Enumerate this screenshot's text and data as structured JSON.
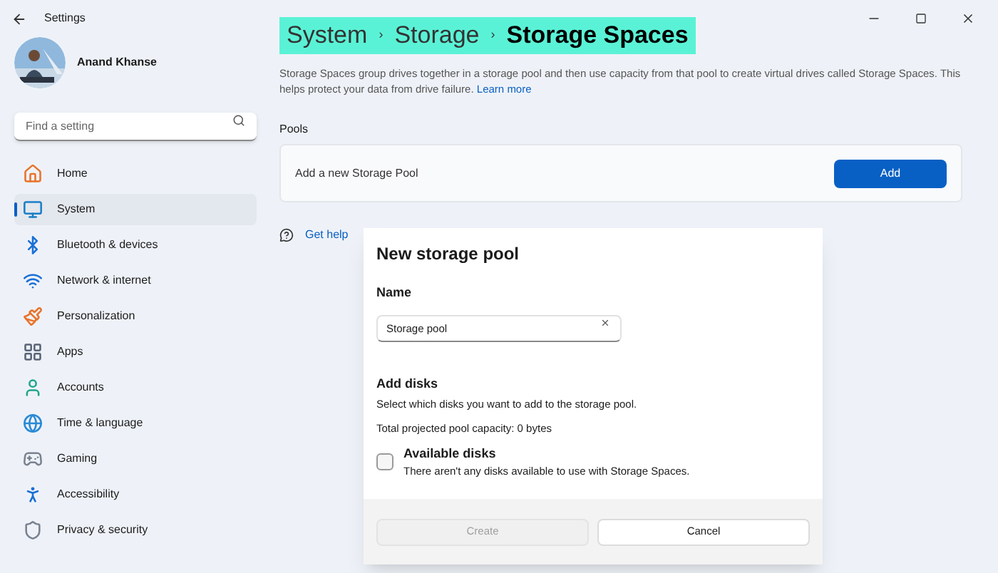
{
  "window": {
    "title": "Settings"
  },
  "user": {
    "name": "Anand Khanse"
  },
  "search": {
    "placeholder": "Find a setting"
  },
  "nav": [
    {
      "label": "Home",
      "kind": "home",
      "selected": false
    },
    {
      "label": "System",
      "kind": "system",
      "selected": true
    },
    {
      "label": "Bluetooth & devices",
      "kind": "bluetooth",
      "selected": false
    },
    {
      "label": "Network & internet",
      "kind": "wifi",
      "selected": false
    },
    {
      "label": "Personalization",
      "kind": "brush",
      "selected": false
    },
    {
      "label": "Apps",
      "kind": "apps",
      "selected": false
    },
    {
      "label": "Accounts",
      "kind": "user",
      "selected": false
    },
    {
      "label": "Time & language",
      "kind": "globe",
      "selected": false
    },
    {
      "label": "Gaming",
      "kind": "gamepad",
      "selected": false
    },
    {
      "label": "Accessibility",
      "kind": "accessibility",
      "selected": false
    },
    {
      "label": "Privacy & security",
      "kind": "shield",
      "selected": false
    }
  ],
  "breadcrumb": [
    {
      "label": "System",
      "current": false
    },
    {
      "label": "Storage",
      "current": false
    },
    {
      "label": "Storage Spaces",
      "current": true
    }
  ],
  "breadcrumb_separator": "›",
  "description": "Storage Spaces group drives together in a storage pool and then use capacity from that pool to create virtual drives called Storage Spaces. This helps protect your data from drive failure.",
  "learn_more": "Learn more",
  "pools": {
    "heading": "Pools",
    "row_label": "Add a new Storage Pool",
    "button": "Add"
  },
  "get_help": "Get help",
  "dialog": {
    "title": "New storage pool",
    "name_label": "Name",
    "name_value": "Storage pool",
    "add_disks_heading": "Add disks",
    "add_disks_text": "Select which disks you want to add to the storage pool.",
    "capacity": "Total projected pool capacity: 0 bytes",
    "available": {
      "title": "Available disks",
      "text": "There aren't any disks available to use with Storage Spaces.",
      "checked": false
    },
    "buttons": [
      {
        "label": "Create",
        "disabled": true
      },
      {
        "label": "Cancel",
        "disabled": false
      }
    ]
  }
}
